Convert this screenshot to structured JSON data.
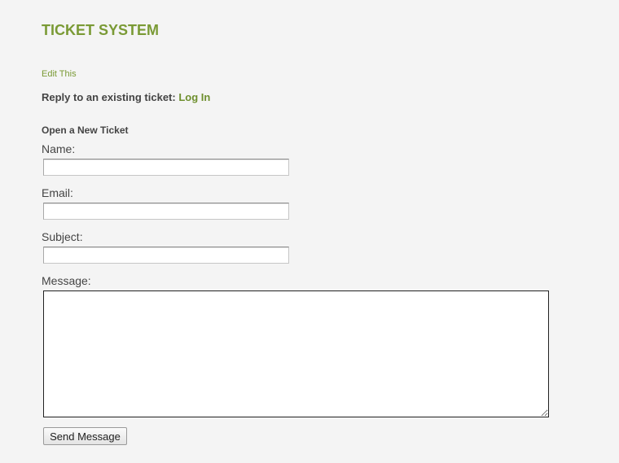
{
  "header": {
    "title": "TICKET SYSTEM",
    "edit_link": "Edit This"
  },
  "reply": {
    "prompt": "Reply to an existing ticket:",
    "login_link": "Log In"
  },
  "form": {
    "heading": "Open a New Ticket",
    "name_label": "Name:",
    "name_value": "",
    "email_label": "Email:",
    "email_value": "",
    "subject_label": "Subject:",
    "subject_value": "",
    "message_label": "Message:",
    "message_value": "",
    "submit_label": "Send Message"
  },
  "colors": {
    "accent": "#7a9a35",
    "background": "#f4f4f4",
    "text": "#444444"
  }
}
